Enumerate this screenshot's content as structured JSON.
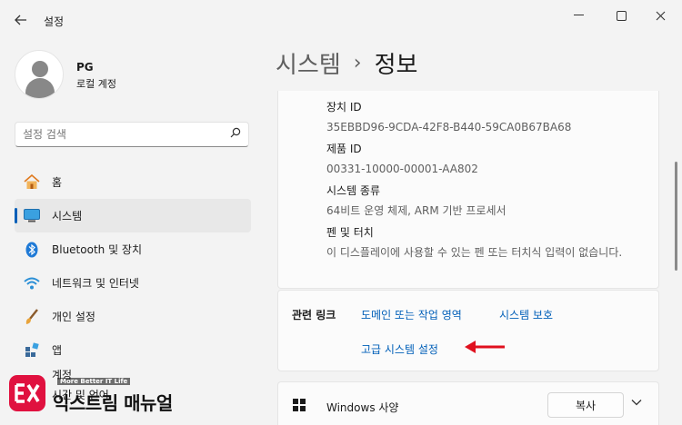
{
  "window": {
    "back_icon": "back-arrow-icon",
    "title": "설정",
    "controls": [
      "minimize-icon",
      "maximize-icon",
      "close-icon"
    ]
  },
  "profile": {
    "name": "PG",
    "account": "로컬 계정"
  },
  "search": {
    "placeholder": "설정 검색",
    "icon": "search-icon"
  },
  "sidebar": {
    "items": [
      {
        "label": "홈",
        "icon": "home-icon",
        "active": false
      },
      {
        "label": "시스템",
        "icon": "system-icon",
        "active": true
      },
      {
        "label": "Bluetooth 및 장치",
        "icon": "bluetooth-icon",
        "active": false
      },
      {
        "label": "네트워크 및 인터넷",
        "icon": "wifi-icon",
        "active": false
      },
      {
        "label": "개인 설정",
        "icon": "brush-icon",
        "active": false
      },
      {
        "label": "앱",
        "icon": "apps-icon",
        "active": false
      },
      {
        "label": "계정",
        "icon": "account-icon",
        "active": false
      },
      {
        "label": "시간 및 언어",
        "icon": "clock-icon",
        "active": false
      }
    ]
  },
  "header": {
    "breadcrumb_parent": "시스템",
    "separator": "›",
    "breadcrumb_current": "정보"
  },
  "specs": {
    "device_id_label": "장치 ID",
    "device_id_value": "35EBBD96-9CDA-42F8-B440-59CA0B67BA68",
    "product_id_label": "제품 ID",
    "product_id_value": "00331-10000-00001-AA802",
    "system_type_label": "시스템 종류",
    "system_type_value": "64비트 운영 체제, ARM 기반 프로세서",
    "pen_touch_label": "펜 및 터치",
    "pen_touch_value": "이 디스플레이에 사용할 수 있는 펜 또는 터치식 입력이 없습니다."
  },
  "related_links": {
    "label": "관련 링크",
    "links": [
      "도메인 또는 작업 영역",
      "시스템 보호",
      "고급 시스템 설정"
    ]
  },
  "windows_spec": {
    "label": "Windows 사양",
    "copy_button": "복사",
    "icon": "windows-logo-icon"
  },
  "watermark": {
    "tagline": "More Better IT Life",
    "name": "익스트림 매뉴얼"
  },
  "colors": {
    "accent": "#005fb8",
    "background": "#f3f3f3",
    "card": "#fbfbfb",
    "annotation_arrow": "#e0101e",
    "watermark_brand": "#e0113f"
  }
}
